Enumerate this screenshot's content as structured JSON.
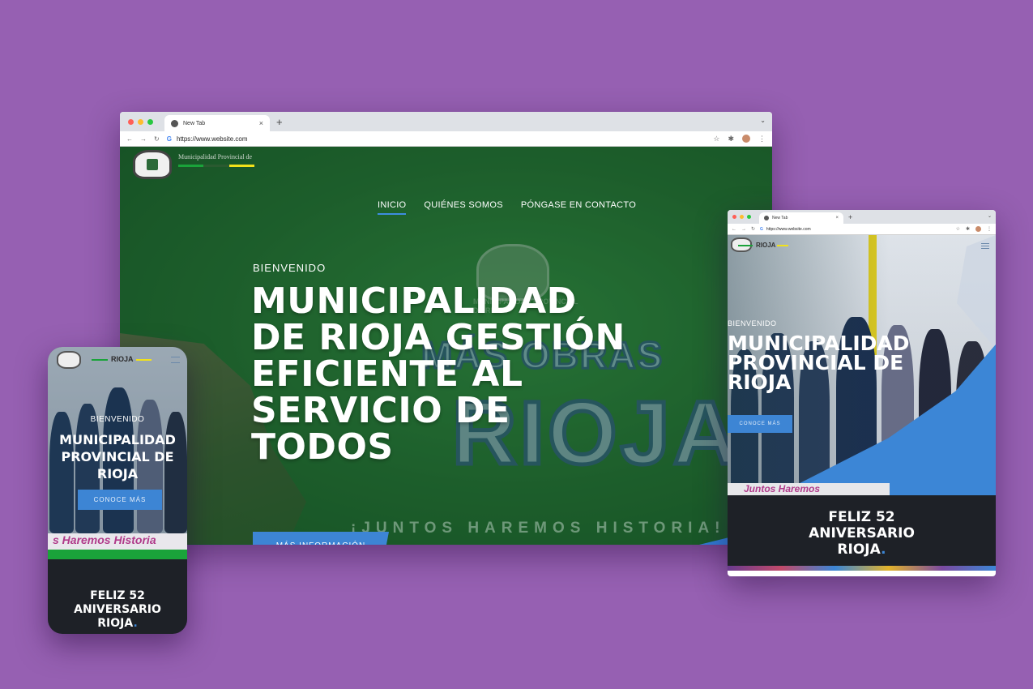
{
  "browser": {
    "tab_title": "New Tab",
    "tab_close": "×",
    "new_tab": "+",
    "tab_menu": "⌄",
    "url": "https://www.website.com",
    "tab_url": "https://www.website.com"
  },
  "desktop": {
    "logo_text": "Municipalidad Provincial de",
    "nav": {
      "items": [
        "INICIO",
        "QUIÉNES SOMOS",
        "PÓNGASE EN CONTACTO"
      ],
      "active": "INICIO"
    },
    "hero": {
      "kicker": "BIENVENIDO",
      "title": "MUNICIPALIDAD DE RIOJA GESTIÓN EFICIENTE AL SERVICIO DE TODOS",
      "button": "MÁS INFORMACIÓN"
    },
    "background": {
      "seal_text": "MUNICIPALIDAD PROVINCIAL\nDE RIOJA",
      "obras": "MÁS OBRAS",
      "rioja": "RIOJA",
      "slogan": "¡JUNTOS HAREMOS HISTORIA!"
    }
  },
  "tablet": {
    "brand": "RIOJA",
    "kicker": "BIENVENIDO",
    "title": "MUNICIPALIDAD PROVINCIAL DE RIOJA",
    "button": "CONOCE MÁS",
    "strip_text": "Juntos Haremos",
    "anniversary": {
      "line1": "FELIZ 52",
      "line2": "ANIVERSARIO",
      "line3": "RIOJA",
      "dot": "."
    }
  },
  "phone": {
    "brand": "RIOJA",
    "kicker": "BIENVENIDO",
    "title": "MUNICIPALIDAD PROVINCIAL DE RIOJA",
    "button": "CONOCE MÁS",
    "strip_text": "s Haremos Historia",
    "anniversary": {
      "line1": "FELIZ 52",
      "line2": "ANIVERSARIO",
      "line3": "RIOJA",
      "dot": "."
    }
  },
  "colors": {
    "background": "#9660b2",
    "hero_green": "#205d2b",
    "accent_blue": "#3d85d4",
    "brand_green": "#1aa33a",
    "brand_yellow": "#f2e21a",
    "dark_band": "#1e2127"
  },
  "icons": [
    "globe-icon",
    "back-arrow-icon",
    "forward-arrow-icon",
    "reload-icon",
    "google-icon",
    "star-icon",
    "extensions-icon",
    "profile-icon",
    "more-menu-icon",
    "hamburger-menu-icon"
  ]
}
